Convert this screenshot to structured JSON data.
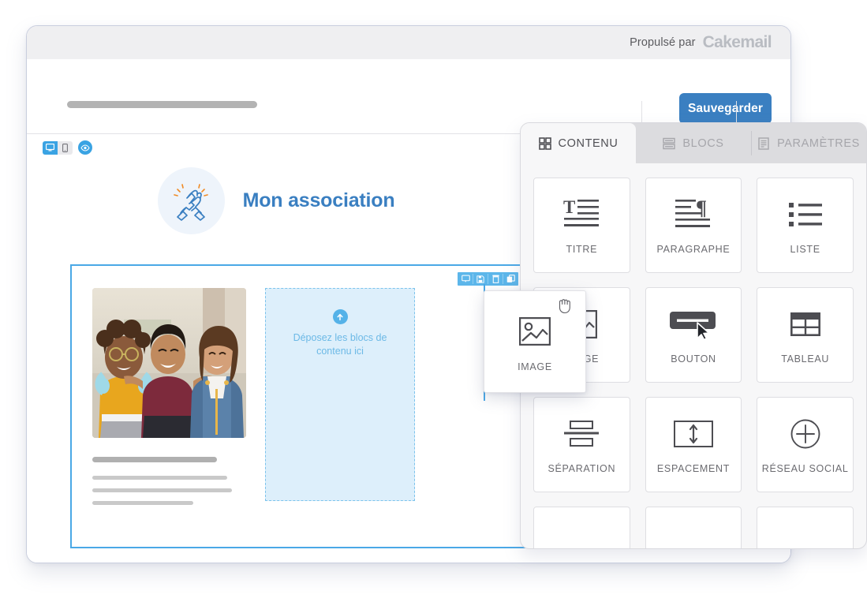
{
  "window": {
    "powered_by_label": "Propulsé par",
    "brand": "Cakemail",
    "save_button": "Sauvegarder"
  },
  "viewmode": {
    "desktop_icon": "desktop-icon",
    "mobile_icon": "mobile-icon",
    "preview_icon": "eye-icon"
  },
  "email": {
    "logo_icon": "solidarity-hands-icon",
    "title": "Mon association",
    "block_toolbar": [
      {
        "icon": "comment-icon",
        "name": "comment"
      },
      {
        "icon": "save-icon",
        "name": "save"
      },
      {
        "icon": "trash-icon",
        "name": "delete"
      },
      {
        "icon": "duplicate-icon",
        "name": "duplicate"
      }
    ],
    "photo_alt": "three-smiling-people-photo",
    "dropzone": {
      "arrow_icon": "arrow-up-circle-icon",
      "label": "Déposez les blocs de contenu ici"
    }
  },
  "panel": {
    "tabs": [
      {
        "label": "CONTENU",
        "icon": "grid-icon",
        "active": true
      },
      {
        "label": "BLOCS",
        "icon": "layers-icon",
        "active": false
      },
      {
        "label": "PARAMÈTRES",
        "icon": "document-icon",
        "active": false
      }
    ],
    "blocks": [
      {
        "label": "TITRE",
        "icon": "heading-icon"
      },
      {
        "label": "PARAGRAPHE",
        "icon": "paragraph-icon"
      },
      {
        "label": "LISTE",
        "icon": "list-icon"
      },
      {
        "label": "IMAGE",
        "icon": "image-icon"
      },
      {
        "label": "BOUTON",
        "icon": "button-icon"
      },
      {
        "label": "TABLEAU",
        "icon": "table-icon"
      },
      {
        "label": "SÉPARATION",
        "icon": "divider-icon"
      },
      {
        "label": "ESPACEMENT",
        "icon": "spacer-icon"
      },
      {
        "label": "RÉSEAU SOCIAL",
        "icon": "plus-circle-icon"
      }
    ],
    "dragged_block": {
      "label": "IMAGE",
      "icon": "image-icon",
      "cursor": "grabbing-hand-cursor"
    }
  },
  "colors": {
    "accent_blue": "#3a7fc1",
    "light_blue": "#4aa8e6",
    "dropzone_bg": "#ddeffb",
    "panel_bg": "#f7f7f8"
  }
}
